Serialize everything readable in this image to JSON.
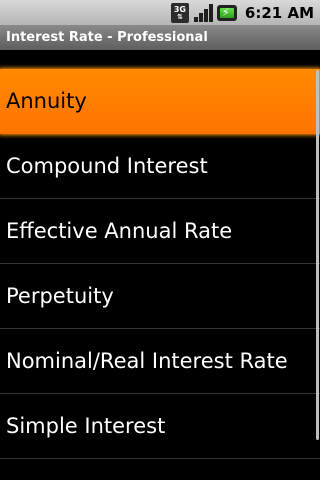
{
  "status_bar": {
    "network_label": "3G",
    "clock": "6:21 AM",
    "icons": [
      "network-3g-icon",
      "signal-icon",
      "battery-charging-icon"
    ]
  },
  "title_bar": {
    "title": "Interest Rate - Professional"
  },
  "list": {
    "items": [
      {
        "label": "Annuity",
        "selected": true
      },
      {
        "label": "Compound Interest",
        "selected": false
      },
      {
        "label": "Effective Annual Rate",
        "selected": false
      },
      {
        "label": "Perpetuity",
        "selected": false
      },
      {
        "label": "Nominal/Real Interest Rate",
        "selected": false
      },
      {
        "label": "Simple Interest",
        "selected": false
      }
    ]
  },
  "colors": {
    "selection": "#ff7f00",
    "background": "#000000",
    "text": "#ffffff"
  }
}
